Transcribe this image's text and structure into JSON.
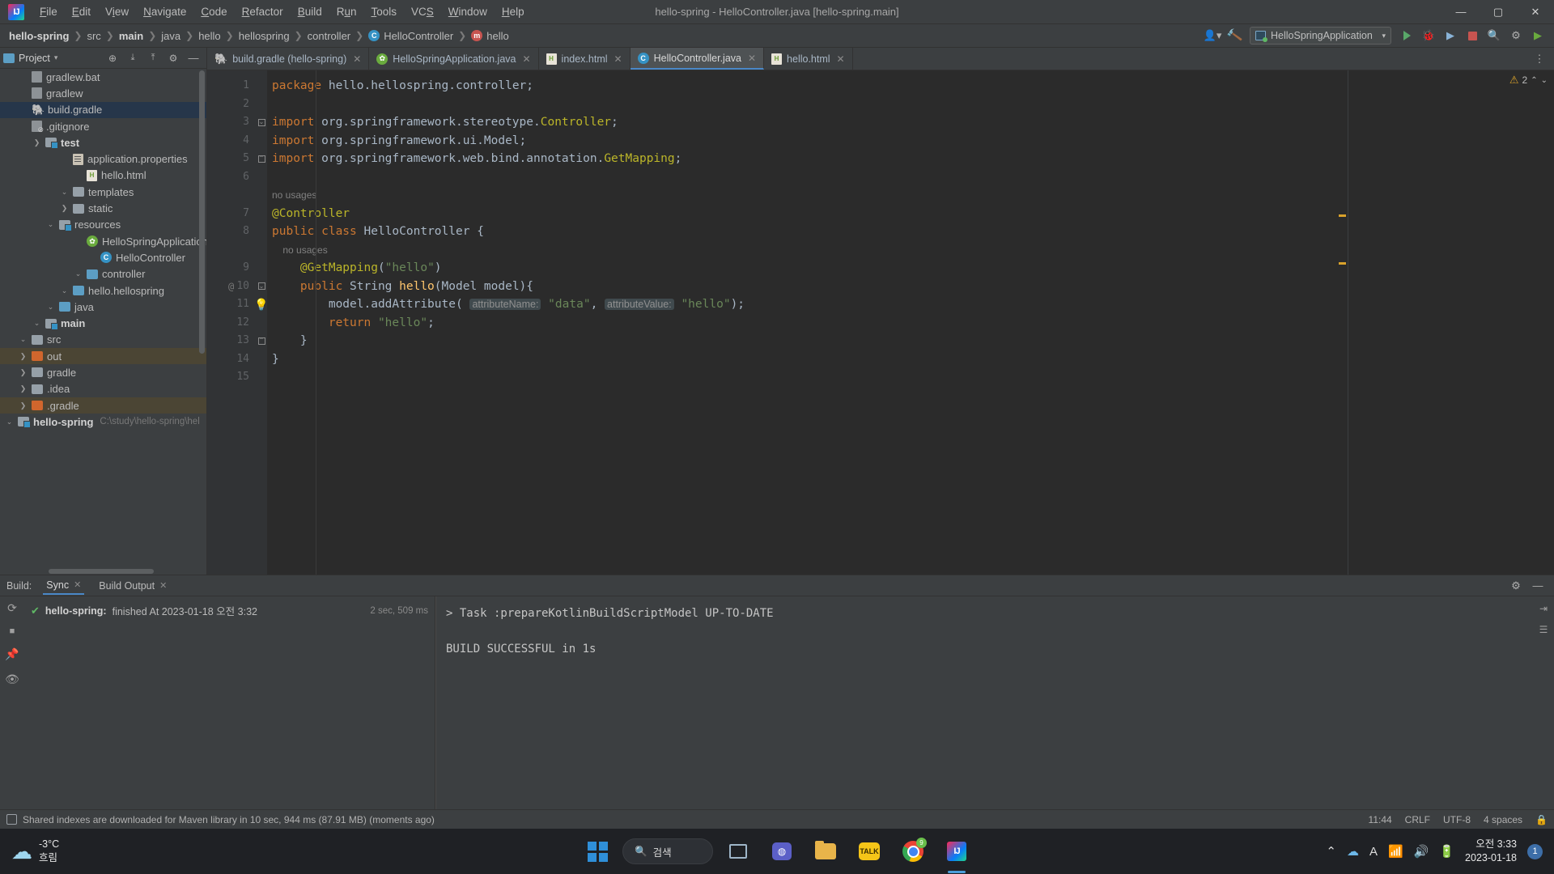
{
  "window": {
    "title": "hello-spring - HelloController.java [hello-spring.main]",
    "minimize": "—",
    "maximize": "▢",
    "close": "✕",
    "logo_text": "IJ"
  },
  "menubar": [
    {
      "label": "File"
    },
    {
      "label": "Edit"
    },
    {
      "label": "View"
    },
    {
      "label": "Navigate"
    },
    {
      "label": "Code"
    },
    {
      "label": "Refactor"
    },
    {
      "label": "Build"
    },
    {
      "label": "Run"
    },
    {
      "label": "Tools"
    },
    {
      "label": "VCS"
    },
    {
      "label": "Window"
    },
    {
      "label": "Help"
    }
  ],
  "breadcrumbs": [
    {
      "label": "hello-spring",
      "bold": true,
      "icon": ""
    },
    {
      "label": "src",
      "bold": false,
      "icon": ""
    },
    {
      "label": "main",
      "bold": true,
      "icon": ""
    },
    {
      "label": "java",
      "bold": false,
      "icon": ""
    },
    {
      "label": "hello",
      "bold": false,
      "icon": ""
    },
    {
      "label": "hellospring",
      "bold": false,
      "icon": ""
    },
    {
      "label": "controller",
      "bold": false,
      "icon": ""
    },
    {
      "label": "HelloController",
      "bold": false,
      "icon": "class-badge"
    },
    {
      "label": "hello",
      "bold": false,
      "icon": "method-badge"
    }
  ],
  "toolbar": {
    "run_config": "HelloSpringApplication",
    "class_badge_letter": "C",
    "method_badge_letter": "m",
    "user_icon": "user-icon",
    "hammer_icon": "build-hammer-icon",
    "run_icon": "run-icon",
    "debug_icon": "debug-icon",
    "stop_icon": "stop-icon",
    "search_icon": "search-icon",
    "settings_icon": "gear-icon",
    "updates_icon": "updates-icon",
    "more_icon": "more-vertical-icon"
  },
  "project_panel": {
    "title": "Project",
    "header_icons": [
      "chevron-down-icon",
      "flatten-packages-icon",
      "expand-all-icon",
      "collapse-all-icon",
      "gear-icon",
      "hide-icon"
    ],
    "tree": [
      {
        "indent": 0,
        "arrow": "v",
        "icon": "module-folder",
        "label": "hello-spring",
        "bold": true,
        "path": "C:\\study\\hello-spring\\hel",
        "state": "normal"
      },
      {
        "indent": 1,
        "arrow": ">",
        "icon": "folder-orange",
        "label": ".gradle",
        "bold": false,
        "path": "",
        "state": "excluded"
      },
      {
        "indent": 1,
        "arrow": ">",
        "icon": "folder-gray",
        "label": ".idea",
        "bold": false,
        "path": "",
        "state": "normal"
      },
      {
        "indent": 1,
        "arrow": ">",
        "icon": "folder-gray",
        "label": "gradle",
        "bold": false,
        "path": "",
        "state": "normal"
      },
      {
        "indent": 1,
        "arrow": ">",
        "icon": "folder-orange",
        "label": "out",
        "bold": false,
        "path": "",
        "state": "excluded"
      },
      {
        "indent": 1,
        "arrow": "v",
        "icon": "folder-gray",
        "label": "src",
        "bold": false,
        "path": "",
        "state": "normal"
      },
      {
        "indent": 2,
        "arrow": "v",
        "icon": "module-folder",
        "label": "main",
        "bold": true,
        "path": "",
        "state": "normal"
      },
      {
        "indent": 3,
        "arrow": "v",
        "icon": "folder-blue",
        "label": "java",
        "bold": false,
        "path": "",
        "state": "normal"
      },
      {
        "indent": 4,
        "arrow": "v",
        "icon": "folder-blue",
        "label": "hello.hellospring",
        "bold": false,
        "path": "",
        "state": "normal"
      },
      {
        "indent": 5,
        "arrow": "v",
        "icon": "folder-blue",
        "label": "controller",
        "bold": false,
        "path": "",
        "state": "normal"
      },
      {
        "indent": 6,
        "arrow": "",
        "icon": "class-file",
        "label": "HelloController",
        "bold": false,
        "path": "",
        "state": "normal"
      },
      {
        "indent": 5,
        "arrow": "",
        "icon": "spring-class",
        "label": "HelloSpringApplication",
        "bold": false,
        "path": "",
        "state": "normal"
      },
      {
        "indent": 3,
        "arrow": "v",
        "icon": "folder-resources",
        "label": "resources",
        "bold": false,
        "path": "",
        "state": "normal"
      },
      {
        "indent": 4,
        "arrow": ">",
        "icon": "folder-gray",
        "label": "static",
        "bold": false,
        "path": "",
        "state": "normal"
      },
      {
        "indent": 4,
        "arrow": "v",
        "icon": "folder-gray",
        "label": "templates",
        "bold": false,
        "path": "",
        "state": "normal"
      },
      {
        "indent": 5,
        "arrow": "",
        "icon": "html-file",
        "label": "hello.html",
        "bold": false,
        "path": "",
        "state": "normal"
      },
      {
        "indent": 4,
        "arrow": "",
        "icon": "props-file",
        "label": "application.properties",
        "bold": false,
        "path": "",
        "state": "normal"
      },
      {
        "indent": 2,
        "arrow": ">",
        "icon": "module-folder",
        "label": "test",
        "bold": true,
        "path": "",
        "state": "normal"
      },
      {
        "indent": 1,
        "arrow": "",
        "icon": "git-file",
        "label": ".gitignore",
        "bold": false,
        "path": "",
        "state": "normal"
      },
      {
        "indent": 1,
        "arrow": "",
        "icon": "gradle-file",
        "label": "build.gradle",
        "bold": false,
        "path": "",
        "state": "selected"
      },
      {
        "indent": 1,
        "arrow": "",
        "icon": "file",
        "label": "gradlew",
        "bold": false,
        "path": "",
        "state": "normal"
      },
      {
        "indent": 1,
        "arrow": "",
        "icon": "file",
        "label": "gradlew.bat",
        "bold": false,
        "path": "",
        "state": "normal"
      }
    ]
  },
  "editor": {
    "tabs": [
      {
        "label": "build.gradle (hello-spring)",
        "icon": "gradle-icon",
        "active": false
      },
      {
        "label": "HelloSpringApplication.java",
        "icon": "spring-icon",
        "active": false
      },
      {
        "label": "index.html",
        "icon": "html-icon",
        "active": false
      },
      {
        "label": "HelloController.java",
        "icon": "class-icon",
        "active": true
      },
      {
        "label": "hello.html",
        "icon": "html-icon",
        "active": false
      }
    ],
    "inspection": {
      "warning_count": "2",
      "warning_icon": "warning-triangle-icon",
      "up_icon": "chevron-up-icon",
      "down_icon": "chevron-down-icon"
    },
    "lines": [
      {
        "num": "1",
        "fold": "",
        "marker": "",
        "segments": [
          {
            "t": "package ",
            "c": "kw"
          },
          {
            "t": "hello.hellospring.controller;",
            "c": "plain"
          }
        ]
      },
      {
        "num": "2",
        "fold": "",
        "marker": "",
        "segments": []
      },
      {
        "num": "3",
        "fold": "start",
        "marker": "",
        "segments": [
          {
            "t": "import ",
            "c": "kw"
          },
          {
            "t": "org.springframework.stereotype.",
            "c": "plain"
          },
          {
            "t": "Controller",
            "c": "ann"
          },
          {
            "t": ";",
            "c": "plain"
          }
        ]
      },
      {
        "num": "4",
        "fold": "",
        "marker": "",
        "segments": [
          {
            "t": "import ",
            "c": "kw"
          },
          {
            "t": "org.springframework.ui.Model;",
            "c": "plain"
          }
        ]
      },
      {
        "num": "5",
        "fold": "end",
        "marker": "",
        "segments": [
          {
            "t": "import ",
            "c": "kw"
          },
          {
            "t": "org.springframework.web.bind.annotation.",
            "c": "plain"
          },
          {
            "t": "GetMapping",
            "c": "ann"
          },
          {
            "t": ";",
            "c": "plain"
          }
        ]
      },
      {
        "num": "6",
        "fold": "",
        "marker": "",
        "segments": []
      },
      {
        "num": "",
        "fold": "",
        "marker": "",
        "hint": "no usages",
        "segments": []
      },
      {
        "num": "7",
        "fold": "",
        "marker": "",
        "segments": [
          {
            "t": "@Controller",
            "c": "ann"
          }
        ]
      },
      {
        "num": "8",
        "fold": "",
        "marker": "",
        "segments": [
          {
            "t": "public ",
            "c": "kw"
          },
          {
            "t": "class ",
            "c": "kw"
          },
          {
            "t": "HelloController ",
            "c": "plain"
          },
          {
            "t": "{",
            "c": "plain"
          }
        ]
      },
      {
        "num": "",
        "fold": "",
        "marker": "",
        "hint": "    no usages",
        "segments": []
      },
      {
        "num": "9",
        "fold": "",
        "marker": "",
        "segments": [
          {
            "t": "    ",
            "c": "plain"
          },
          {
            "t": "@GetMapping",
            "c": "ann"
          },
          {
            "t": "(",
            "c": "plain"
          },
          {
            "t": "\"hello\"",
            "c": "str"
          },
          {
            "t": ")",
            "c": "plain"
          }
        ]
      },
      {
        "num": "10",
        "fold": "start",
        "marker": "@",
        "segments": [
          {
            "t": "    ",
            "c": "plain"
          },
          {
            "t": "public ",
            "c": "kw"
          },
          {
            "t": "String ",
            "c": "plain"
          },
          {
            "t": "hello",
            "c": "meth"
          },
          {
            "t": "(Model model){",
            "c": "plain"
          }
        ]
      },
      {
        "num": "11",
        "fold": "",
        "marker": "bulb",
        "segments": [
          {
            "t": "        model.",
            "c": "plain"
          },
          {
            "t": "addAttribute",
            "c": "plain"
          },
          {
            "t": "( ",
            "c": "plain"
          },
          {
            "t": "attributeName:",
            "c": "hintparam"
          },
          {
            "t": " ",
            "c": "plain"
          },
          {
            "t": "\"data\"",
            "c": "str"
          },
          {
            "t": ", ",
            "c": "plain"
          },
          {
            "t": "attributeValue:",
            "c": "hintparam"
          },
          {
            "t": " ",
            "c": "plain"
          },
          {
            "t": "\"hello\"",
            "c": "str"
          },
          {
            "t": ");",
            "c": "plain"
          }
        ]
      },
      {
        "num": "12",
        "fold": "",
        "marker": "",
        "segments": [
          {
            "t": "        ",
            "c": "plain"
          },
          {
            "t": "return ",
            "c": "kw"
          },
          {
            "t": "\"hello\"",
            "c": "str"
          },
          {
            "t": ";",
            "c": "plain"
          }
        ]
      },
      {
        "num": "13",
        "fold": "end",
        "marker": "",
        "segments": [
          {
            "t": "    }",
            "c": "plain"
          }
        ]
      },
      {
        "num": "14",
        "fold": "",
        "marker": "",
        "segments": [
          {
            "t": "}",
            "c": "plain"
          }
        ]
      },
      {
        "num": "15",
        "fold": "",
        "marker": "",
        "segments": []
      }
    ]
  },
  "build_panel": {
    "label": "Build:",
    "tabs": [
      {
        "label": "Sync",
        "active": true,
        "closeable": true
      },
      {
        "label": "Build Output",
        "active": false,
        "closeable": true
      }
    ],
    "gutter_icons": [
      "rerun-icon",
      "stop-icon",
      "pin-icon",
      "eye-icon"
    ],
    "tree": [
      {
        "status": "success",
        "name": "hello-spring:",
        "text": "finished At 2023-01-18 오전 3:32",
        "time": "2 sec, 509 ms"
      }
    ],
    "output": [
      "> Task :prepareKotlinBuildScriptModel UP-TO-DATE",
      "",
      "BUILD SUCCESSFUL in 1s"
    ],
    "header_icons": [
      "gear-icon",
      "hide-icon"
    ],
    "right_icons": [
      "expand-icon",
      "settings-icon"
    ]
  },
  "statusbar": {
    "message": "Shared indexes are downloaded for Maven library in 10 sec, 944 ms (87.91 MB) (moments ago)",
    "db_icon": "database-icon",
    "position": "11:44",
    "line_sep": "CRLF",
    "encoding": "UTF-8",
    "indent": "4 spaces"
  },
  "taskbar": {
    "weather": {
      "temp": "-3°C",
      "desc": "흐림",
      "icon": "cloud-icon"
    },
    "start_label": "start-icon",
    "search_placeholder": "검색",
    "search_icon": "search-icon",
    "apps": [
      {
        "name": "task-view-icon",
        "glyph": "▭"
      },
      {
        "name": "teams-icon",
        "glyph": "◍"
      },
      {
        "name": "file-explorer-icon",
        "glyph": "📁"
      },
      {
        "name": "kakaotalk-icon",
        "glyph": "TALK"
      },
      {
        "name": "chrome-icon",
        "glyph": "",
        "badge": "9"
      },
      {
        "name": "intellij-icon",
        "glyph": "IJ",
        "active": true
      }
    ],
    "tray": [
      "chevron-up-icon",
      "onedrive-icon",
      "ime-icon",
      "wifi-icon",
      "volume-icon",
      "battery-icon"
    ],
    "clock": {
      "time": "오전 3:33",
      "date": "2023-01-18"
    },
    "notif_count": "1"
  },
  "colors": {
    "accent": "#4a88c7",
    "bg_panel": "#3c3f41",
    "bg_editor": "#2b2b2b",
    "keyword": "#cc7832",
    "string": "#6a8759",
    "annotation": "#bbb529",
    "method": "#ffc66d",
    "text": "#a9b7c6",
    "success": "#5fb865",
    "warning": "#d9a22b"
  }
}
